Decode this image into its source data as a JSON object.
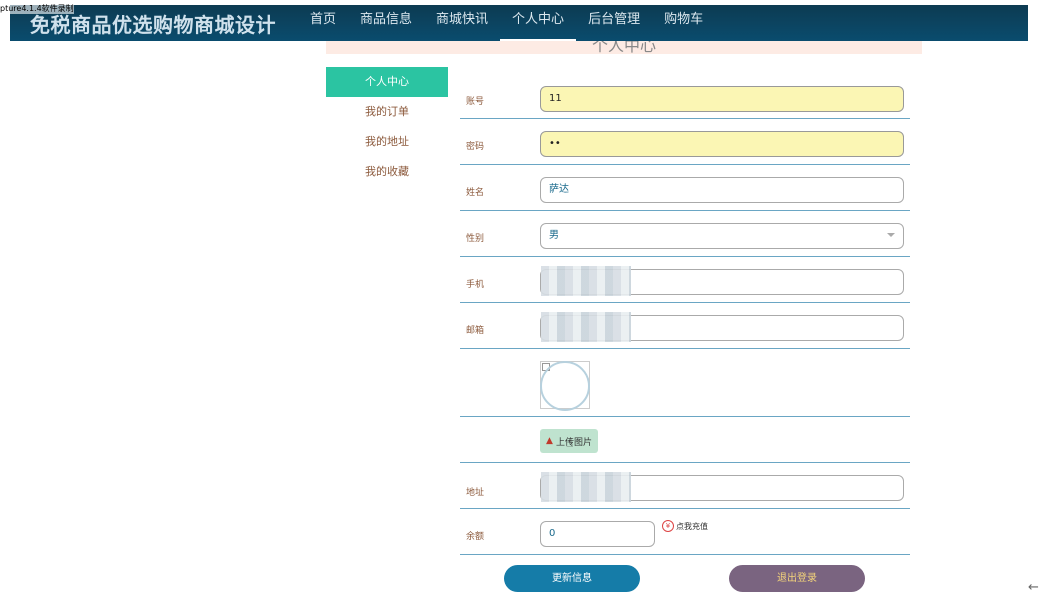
{
  "watermark": "pture4.1.4软件录制",
  "brand": "免税商品优选购物商城设计",
  "nav": [
    "首页",
    "商品信息",
    "商城快讯",
    "个人中心",
    "后台管理",
    "购物车"
  ],
  "page_title": "个人中心",
  "sidebar": [
    "个人中心",
    "我的订单",
    "我的地址",
    "我的收藏"
  ],
  "form": {
    "account_label": "账号",
    "account_value": "11",
    "password_label": "密码",
    "password_value": "••",
    "name_label": "姓名",
    "name_value": "萨达",
    "gender_label": "性别",
    "gender_value": "男",
    "phone_label": "手机",
    "email_label": "邮箱",
    "upload_label": "上传图片",
    "address_label": "地址",
    "balance_label": "余额",
    "balance_value": "0",
    "recharge_label": "点我充值",
    "yen_icon": "¥"
  },
  "buttons": {
    "update": "更新信息",
    "logout": "退出登录"
  },
  "back_icon": "←",
  "colors": {
    "nav_bg": "#0a4c6e",
    "accent": "#2bc4a2",
    "update_btn": "#157ca8",
    "logout_btn": "#7a6480"
  }
}
